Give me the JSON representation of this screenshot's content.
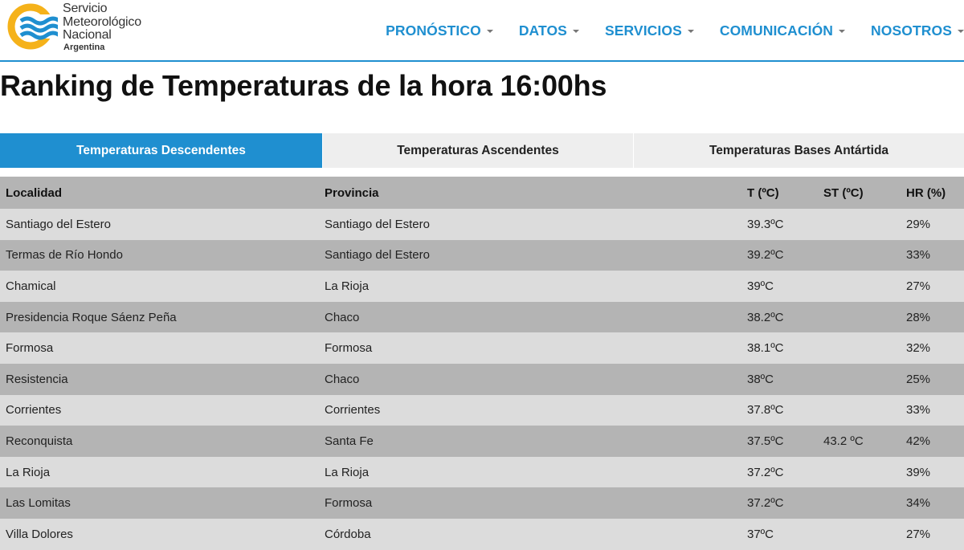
{
  "brand": {
    "line1": "Servicio",
    "line2": "Meteorológico",
    "line3": "Nacional",
    "country": "Argentina",
    "colors": {
      "ring": "#f5b21a",
      "waves": "#1f8fd0"
    }
  },
  "nav": {
    "items": [
      {
        "label": "PRONÓSTICO"
      },
      {
        "label": "DATOS"
      },
      {
        "label": "SERVICIOS"
      },
      {
        "label": "COMUNICACIÓN"
      },
      {
        "label": "NOSOTROS"
      }
    ],
    "color": "#1f8fd0"
  },
  "page": {
    "title": "Ranking de Temperaturas de la hora 16:00hs"
  },
  "tabs": [
    {
      "label": "Temperaturas Descendentes",
      "active": true
    },
    {
      "label": "Temperaturas Ascendentes",
      "active": false
    },
    {
      "label": "Temperaturas Bases Antártida",
      "active": false
    }
  ],
  "table": {
    "headers": {
      "localidad": "Localidad",
      "provincia": "Provincia",
      "t": "T (ºC)",
      "st": "ST (ºC)",
      "hr": "HR (%)"
    },
    "rows": [
      {
        "localidad": "Santiago del Estero",
        "provincia": "Santiago del Estero",
        "t": "39.3ºC",
        "st": "",
        "hr": "29%"
      },
      {
        "localidad": "Termas de Río Hondo",
        "provincia": "Santiago del Estero",
        "t": "39.2ºC",
        "st": "",
        "hr": "33%"
      },
      {
        "localidad": "Chamical",
        "provincia": "La Rioja",
        "t": "39ºC",
        "st": "",
        "hr": "27%"
      },
      {
        "localidad": "Presidencia Roque Sáenz Peña",
        "provincia": "Chaco",
        "t": "38.2ºC",
        "st": "",
        "hr": "28%"
      },
      {
        "localidad": "Formosa",
        "provincia": "Formosa",
        "t": "38.1ºC",
        "st": "",
        "hr": "32%"
      },
      {
        "localidad": "Resistencia",
        "provincia": "Chaco",
        "t": "38ºC",
        "st": "",
        "hr": "25%"
      },
      {
        "localidad": "Corrientes",
        "provincia": "Corrientes",
        "t": "37.8ºC",
        "st": "",
        "hr": "33%"
      },
      {
        "localidad": "Reconquista",
        "provincia": "Santa Fe",
        "t": "37.5ºC",
        "st": "43.2 ºC",
        "hr": "42%"
      },
      {
        "localidad": "La Rioja",
        "provincia": "La Rioja",
        "t": "37.2ºC",
        "st": "",
        "hr": "39%"
      },
      {
        "localidad": "Las Lomitas",
        "provincia": "Formosa",
        "t": "37.2ºC",
        "st": "",
        "hr": "34%"
      },
      {
        "localidad": "Villa Dolores",
        "provincia": "Córdoba",
        "t": "37ºC",
        "st": "",
        "hr": "27%"
      }
    ]
  }
}
